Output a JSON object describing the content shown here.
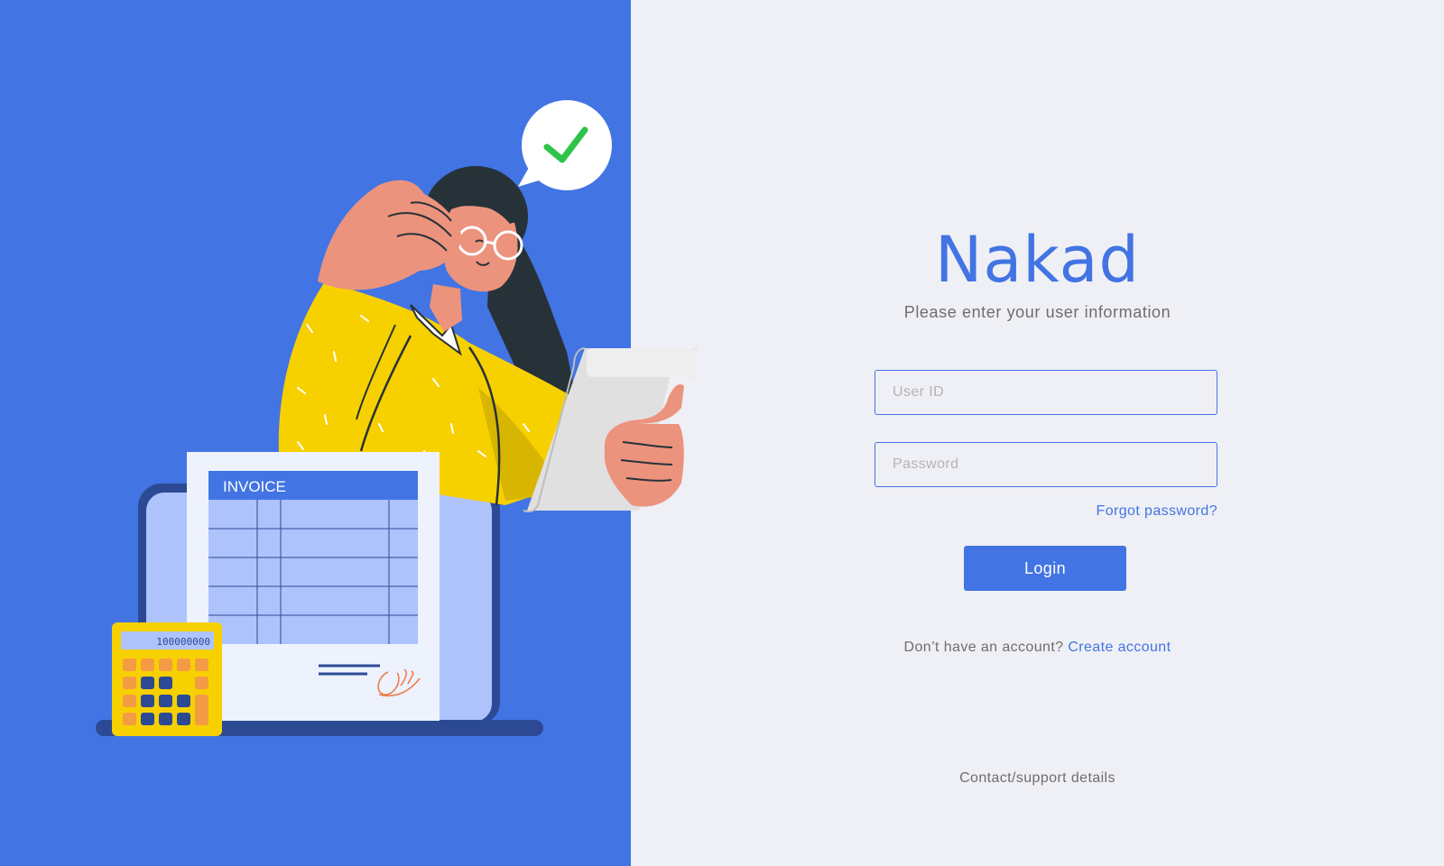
{
  "brand": {
    "name": "Nakad"
  },
  "login": {
    "subtitle": "Please enter your user information",
    "user_id_placeholder": "User ID",
    "password_placeholder": "Password",
    "forgot_label": "Forgot password?",
    "login_label": "Login",
    "no_account_text": "Don’t have an account?",
    "create_account_label": "Create account",
    "support_label": "Contact/support details"
  },
  "illustration": {
    "invoice_title": "INVOICE",
    "calculator_display": "100000000",
    "speech_bubble_icon": "check-icon"
  },
  "colors": {
    "accent": "#4274e3",
    "panel_background": "#eff0f5",
    "check_green": "#2ec44a",
    "sweater_yellow": "#f7d000"
  }
}
